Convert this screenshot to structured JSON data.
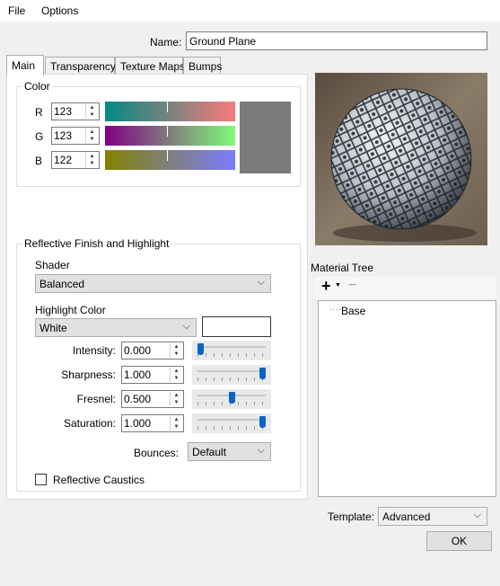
{
  "menu": {
    "file": "File",
    "options": "Options"
  },
  "name": {
    "label": "Name:",
    "value": "Ground Plane"
  },
  "tabs": [
    "Main",
    "Transparency",
    "Texture Maps",
    "Bumps"
  ],
  "color": {
    "title": "Color",
    "r": {
      "label": "R",
      "value": "123"
    },
    "g": {
      "label": "G",
      "value": "123"
    },
    "b": {
      "label": "B",
      "value": "122"
    },
    "swatch": "#7b7b7a"
  },
  "reflective": {
    "title": "Reflective Finish and Highlight",
    "shader_label": "Shader",
    "shader_value": "Balanced",
    "highlight_label": "Highlight Color",
    "highlight_value": "White",
    "highlight_swatch": "#ffffff",
    "intensity": {
      "label": "Intensity:",
      "value": "0.000",
      "level": 0.0
    },
    "sharpness": {
      "label": "Sharpness:",
      "value": "1.000",
      "level": 1.0
    },
    "fresnel": {
      "label": "Fresnel:",
      "value": "0.500",
      "level": 0.5
    },
    "saturation": {
      "label": "Saturation:",
      "value": "1.000",
      "level": 1.0
    },
    "bounces_label": "Bounces:",
    "bounces_value": "Default",
    "caustics_label": "Reflective Caustics"
  },
  "material_tree": {
    "title": "Material Tree",
    "add_icon": "plus-icon",
    "remove_icon": "minus-icon",
    "items": [
      "Base"
    ]
  },
  "template": {
    "label": "Template:",
    "value": "Advanced"
  },
  "ok_label": "OK"
}
